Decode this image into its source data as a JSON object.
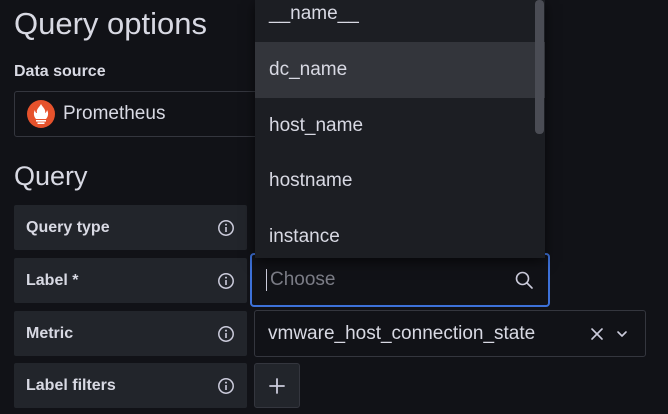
{
  "page": {
    "title": "Query options",
    "data_source_label": "Data source",
    "query_section": "Query"
  },
  "data_source": {
    "name": "Prometheus",
    "logo": "prometheus-logo",
    "logo_color": "#e6522c"
  },
  "rows": [
    {
      "label": "Query type"
    },
    {
      "label": "Label *"
    },
    {
      "label": "Metric"
    },
    {
      "label": "Label filters"
    }
  ],
  "label_input": {
    "placeholder": "Choose",
    "focus_color": "#3d71d9"
  },
  "metric": {
    "value": "vmware_host_connection_state"
  },
  "dropdown": {
    "items": [
      {
        "label": "__name__"
      },
      {
        "label": "dc_name"
      },
      {
        "label": "host_name"
      },
      {
        "label": "hostname"
      },
      {
        "label": "instance"
      }
    ],
    "highlighted_index": 1
  },
  "icons": {
    "info": "info-icon",
    "search": "search-icon",
    "clear": "close-icon",
    "chevron": "chevron-down-icon",
    "add": "plus-icon"
  }
}
